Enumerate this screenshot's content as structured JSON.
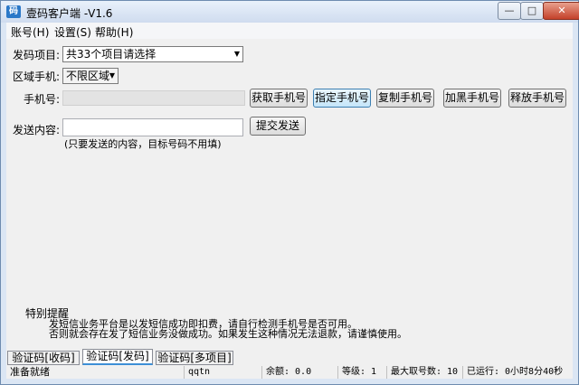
{
  "window": {
    "title": "壹码客户端 -V1.6",
    "icon": "app-icon",
    "minimize": "—",
    "maximize": "□",
    "close": "✕"
  },
  "menu": [
    {
      "label": "账号(H)"
    },
    {
      "label": "设置(S)"
    },
    {
      "label": "帮助(H)"
    }
  ],
  "form": {
    "project_label": "发码项目:",
    "project_value": "共33个项目请选择",
    "region_label": "区域手机:",
    "region_value": "不限区域",
    "phone_label": "手机号:",
    "phone_value": "",
    "content_label": "发送内容:",
    "content_value": "",
    "content_hint": "(只要发送的内容，目标号码不用填)"
  },
  "buttons": {
    "get_phone": "获取手机号",
    "assign_phone": "指定手机号",
    "copy_phone": "复制手机号",
    "blacklist_phone": "加黑手机号",
    "release_phone": "释放手机号",
    "submit": "提交发送"
  },
  "notice": {
    "title": "特别提醒",
    "line1": "发短信业务平台是以发短信成功即扣费，请自行检测手机号是否可用。",
    "line2": "否则就会存在发了短信业务没做成功。如果发生这种情况无法退款，请谨慎使用。"
  },
  "tabs": [
    {
      "label": "验证码[收码]"
    },
    {
      "label": "验证码[发码]"
    },
    {
      "label": "验证码[多项目]"
    }
  ],
  "status": {
    "ready": "准备就绪",
    "user": "qqtn",
    "balance": "余额: 0.0",
    "level": "等级: 1",
    "max_phones": "最大取号数: 10",
    "runtime": "已运行: 0小时8分40秒"
  }
}
